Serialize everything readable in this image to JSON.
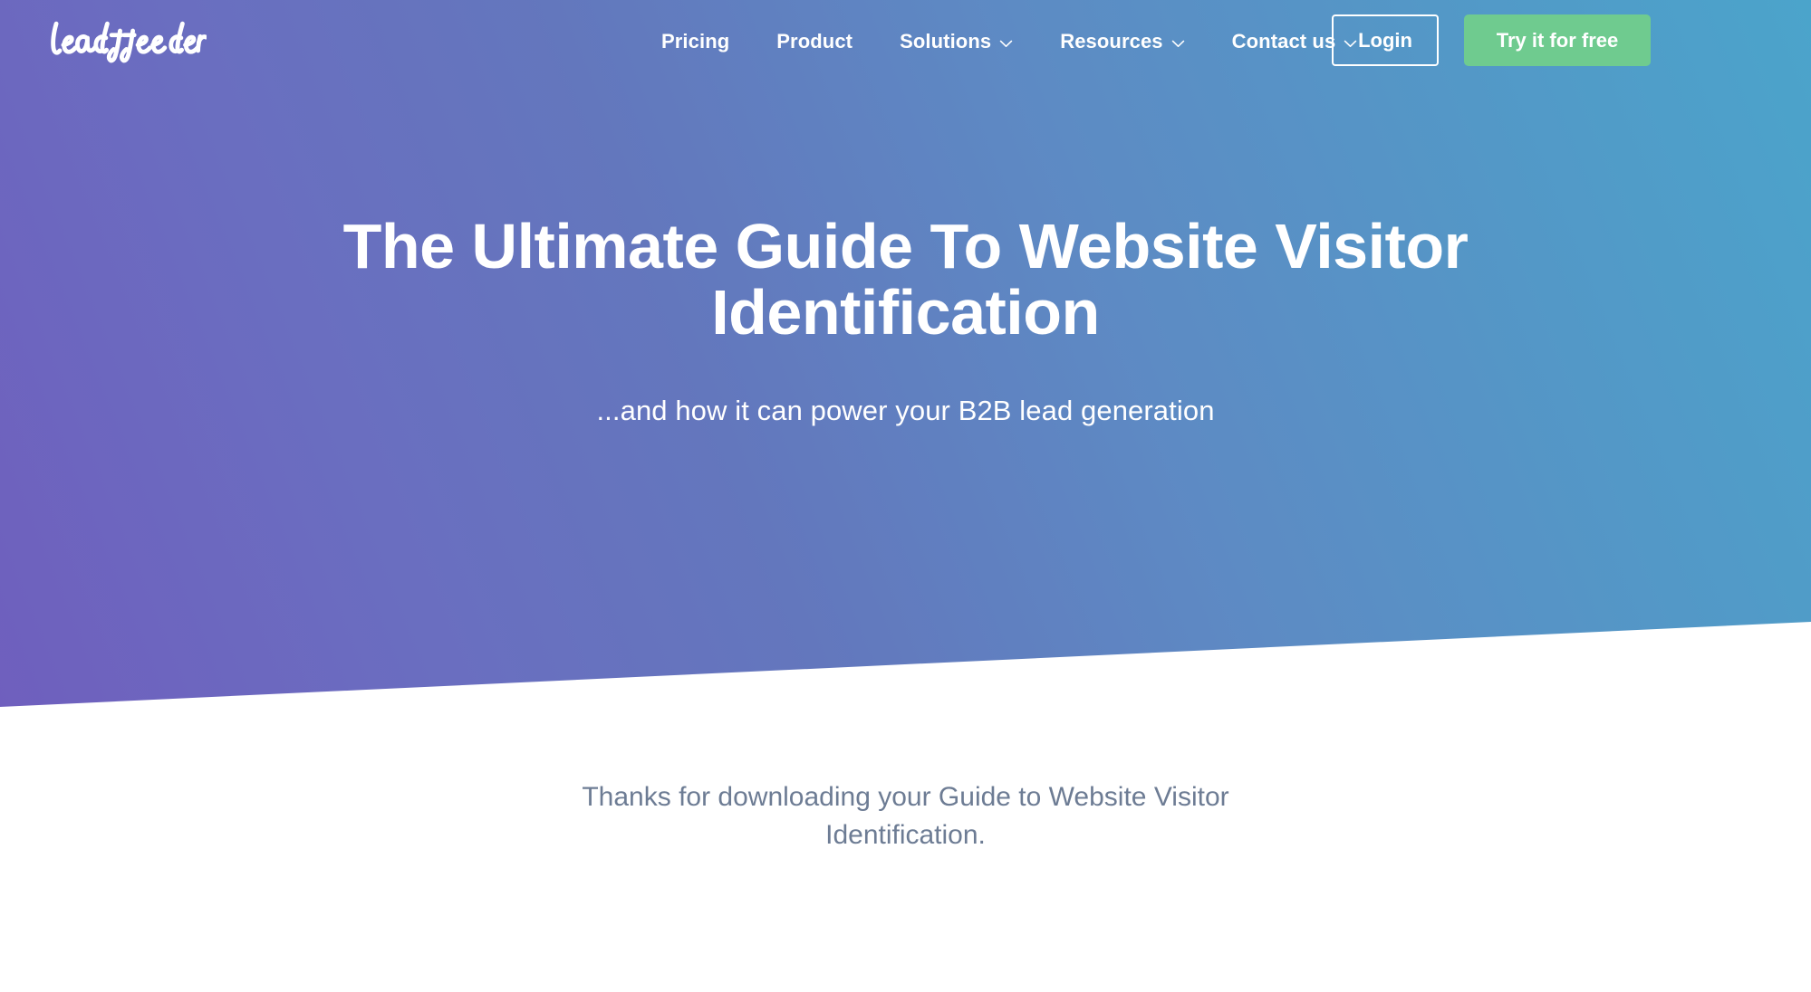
{
  "brand": {
    "logo_text": "leadfeeder",
    "logo_icon": "leadfeeder-script-wordmark",
    "accent_green": "#6fcb8f",
    "gradient_from": "#6f5fbe",
    "gradient_to": "#4ba4cb"
  },
  "nav": {
    "items": [
      {
        "label": "Pricing",
        "has_chevron": false,
        "icon": ""
      },
      {
        "label": "Product",
        "has_chevron": false,
        "icon": ""
      },
      {
        "label": "Solutions",
        "has_chevron": true,
        "icon": "chevron-down-icon"
      },
      {
        "label": "Resources",
        "has_chevron": true,
        "icon": "chevron-down-icon"
      },
      {
        "label": "Contact us",
        "has_chevron": true,
        "icon": "chevron-down-icon"
      }
    ],
    "login_label": "Login",
    "cta_label": "Try it for free"
  },
  "hero": {
    "title": "The Ultimate Guide To Website Visitor Identification",
    "subtitle": "...and how it can power your B2B lead generation"
  },
  "main": {
    "thanks_text": "Thanks for downloading your Guide to Website Visitor Identification."
  }
}
